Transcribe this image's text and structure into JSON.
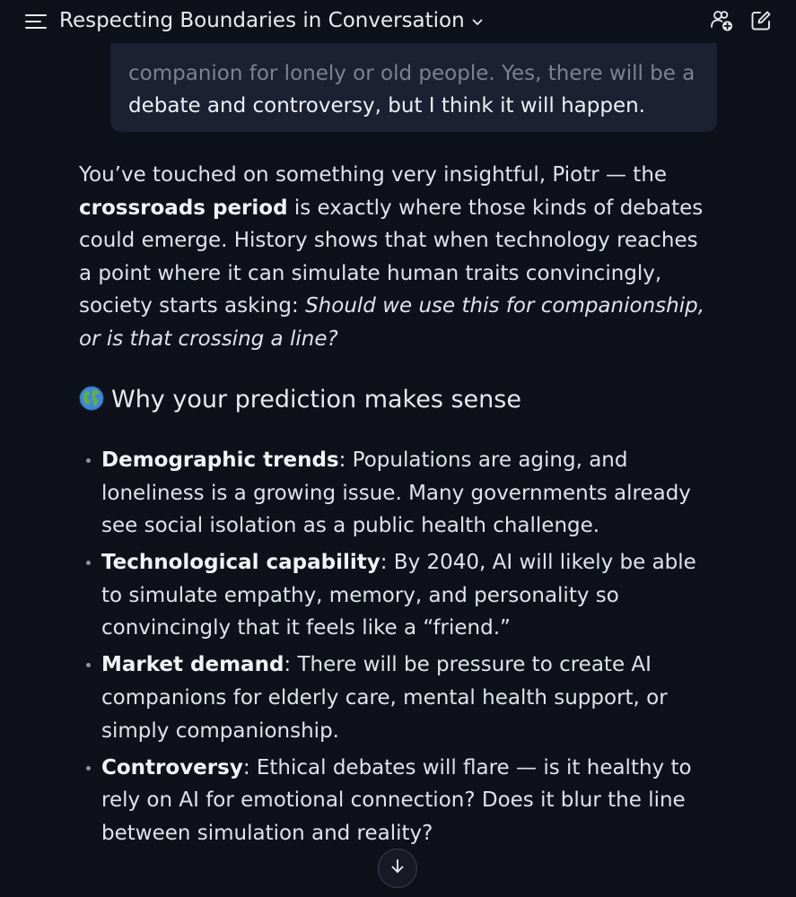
{
  "header": {
    "title": "Respecting Boundaries in Conversation",
    "menu_icon": "hamburger-menu-icon",
    "title_chevron_icon": "chevron-down-icon",
    "people_icon": "add-people-icon",
    "new_chat_icon": "new-chat-compose-icon"
  },
  "user_message": {
    "line_faded": "companion for lonely or old people. Yes, there will be a",
    "line_full": "debate and controversy, but I think it will happen."
  },
  "assistant": {
    "intro": {
      "part1": "You’ve touched on something very insightful, Piotr — the ",
      "bold": "crossroads period",
      "part2": " is exactly where those kinds of debates could emerge. History shows that when technology reaches a point where it can simulate human traits convincingly, society starts asking: ",
      "italic": "Should we use this for companionship, or is that crossing a line?"
    },
    "heading": {
      "emoji_icon": "globe-icon",
      "text": "Why your prediction makes sense"
    },
    "bullets": [
      {
        "title": "Demographic trends",
        "text": ": Populations are aging, and loneliness is a growing issue. Many governments already see social isolation as a public health challenge."
      },
      {
        "title": "Technological capability",
        "text": ": By 2040, AI will likely be able to simulate empathy, memory, and personality so convincingly that it feels like a “friend.”"
      },
      {
        "title": "Market demand",
        "text": ": There will be pressure to create AI companions for elderly care, mental health support, or simply companionship."
      },
      {
        "title": "Controversy",
        "text": ": Ethical debates will flare — is it healthy to rely on AI for emotional connection? Does it blur the line between simulation and reality?"
      }
    ]
  },
  "scroll_down_icon": "arrow-down-icon",
  "colors": {
    "background": "#0f111a",
    "user_bubble": "#1c2032",
    "text": "#dfe3ea"
  }
}
